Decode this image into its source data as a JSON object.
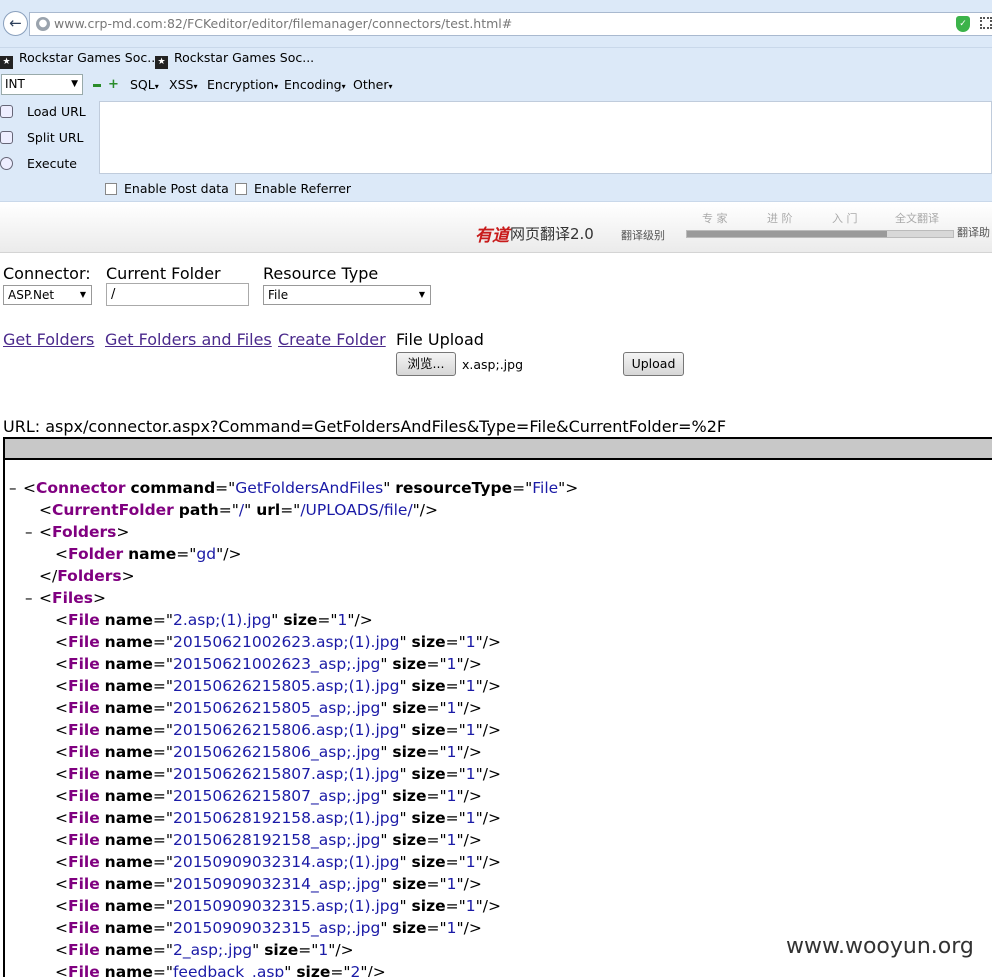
{
  "browser": {
    "url": "www.crp-md.com:82/FCKeditor/editor/filemanager/connectors/test.html#",
    "bookmarks": [
      "Rockstar Games Soc...",
      "Rockstar Games Soc..."
    ]
  },
  "hackbar": {
    "select_value": "INT",
    "menus": [
      "SQL",
      "XSS",
      "Encryption",
      "Encoding",
      "Other"
    ],
    "load_url": "Load URL",
    "split_url": "Split URL",
    "execute": "Execute",
    "enable_post": "Enable Post data",
    "enable_referrer": "Enable Referrer"
  },
  "youdao": {
    "logo": "有道",
    "name": "网页翻译2.0",
    "level_label": "翻译级别",
    "levels": [
      "专 家",
      "进 阶",
      "入 门",
      "全文翻译"
    ],
    "level_value": 0.75,
    "trans_help": "翻译助"
  },
  "form": {
    "connector_label": "Connector:",
    "connector_value": "ASP.Net",
    "folder_label": "Current Folder",
    "folder_value": "/",
    "resource_label": "Resource Type",
    "resource_value": "File",
    "links": [
      "Get Folders",
      "Get Folders and Files",
      "Create Folder"
    ],
    "file_upload_label": "File Upload",
    "browse_button": "浏览...",
    "file_name": "x.asp;.jpg",
    "upload_button": "Upload",
    "url_line": "URL: aspx/connector.aspx?Command=GetFoldersAndFiles&Type=File&CurrentFolder=%2F"
  },
  "xml": {
    "connector": {
      "tag": "Connector",
      "command": "GetFoldersAndFiles",
      "resourceType": "File"
    },
    "current_folder": {
      "tag": "CurrentFolder",
      "path": "/",
      "url": "/UPLOADS/file/"
    },
    "folders_tag": "Folders",
    "folder": {
      "tag": "Folder",
      "name": "gd"
    },
    "files_tag": "Files",
    "first_file": {
      "tag": "File",
      "name": "2.asp;(1).jpg",
      "size": "1"
    },
    "files": [
      {
        "name": "20150621002623.asp;(1).jpg",
        "size": "1"
      },
      {
        "name": "20150621002623_asp;.jpg",
        "size": "1"
      },
      {
        "name": "20150626215805.asp;(1).jpg",
        "size": "1"
      },
      {
        "name": "20150626215805_asp;.jpg",
        "size": "1"
      },
      {
        "name": "20150626215806.asp;(1).jpg",
        "size": "1"
      },
      {
        "name": "20150626215806_asp;.jpg",
        "size": "1"
      },
      {
        "name": "20150626215807.asp;(1).jpg",
        "size": "1"
      },
      {
        "name": "20150626215807_asp;.jpg",
        "size": "1"
      },
      {
        "name": "20150628192158.asp;(1).jpg",
        "size": "1"
      },
      {
        "name": "20150628192158_asp;.jpg",
        "size": "1"
      },
      {
        "name": "20150909032314.asp;(1).jpg",
        "size": "1"
      },
      {
        "name": "20150909032314_asp;.jpg",
        "size": "1"
      },
      {
        "name": "20150909032315.asp;(1).jpg",
        "size": "1"
      },
      {
        "name": "20150909032315_asp;.jpg",
        "size": "1"
      },
      {
        "name": "2_asp;.jpg",
        "size": "1"
      },
      {
        "name": "feedback_.asp",
        "size": "2"
      }
    ]
  },
  "watermark": "www.wooyun.org"
}
